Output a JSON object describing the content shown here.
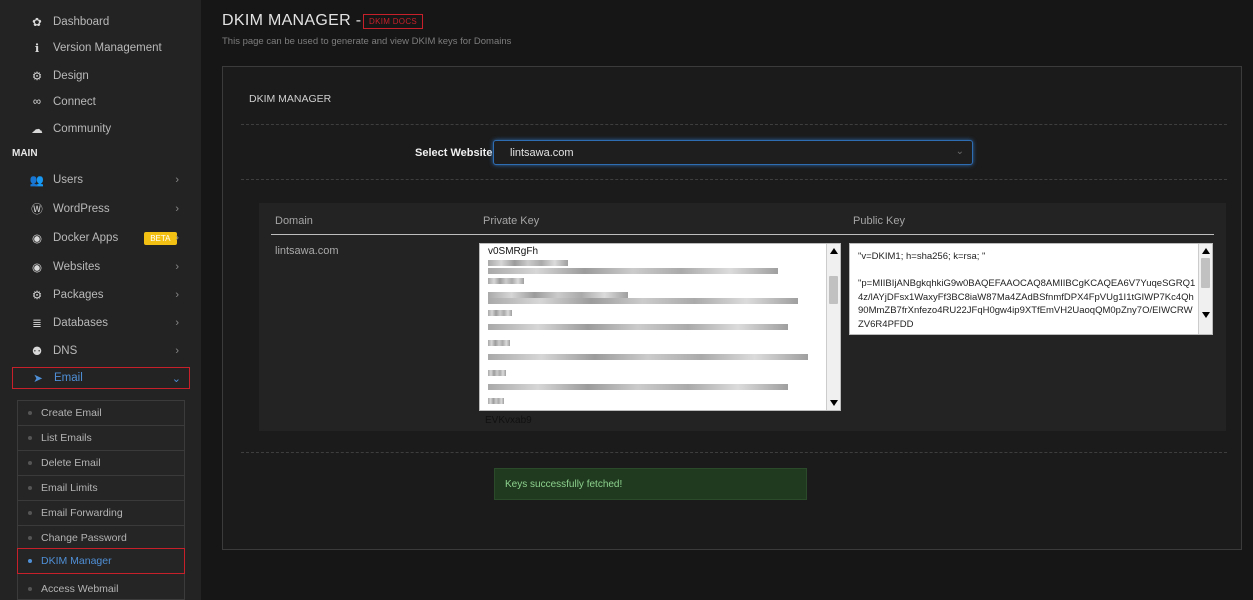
{
  "sidebar": {
    "items": [
      {
        "label": "Dashboard",
        "icon": "dashboard-icon",
        "glyph": "✿"
      },
      {
        "label": "Version Management",
        "icon": "info-icon",
        "glyph": "ℹ"
      },
      {
        "label": "Design",
        "icon": "gear-icon",
        "glyph": "⚙"
      },
      {
        "label": "Connect",
        "icon": "link-icon",
        "glyph": "∞"
      },
      {
        "label": "Community",
        "icon": "chat-icon",
        "glyph": "☁"
      }
    ],
    "section_label": "MAIN",
    "main_items": [
      {
        "label": "Users",
        "icon": "users-icon",
        "glyph": "👥"
      },
      {
        "label": "WordPress",
        "icon": "wordpress-icon",
        "glyph": "Ⓦ"
      },
      {
        "label": "Docker Apps",
        "icon": "docker-icon",
        "glyph": "◉",
        "badge": "BETA"
      },
      {
        "label": "Websites",
        "icon": "globe-icon",
        "glyph": "◉"
      },
      {
        "label": "Packages",
        "icon": "packages-icon",
        "glyph": "⚙"
      },
      {
        "label": "Databases",
        "icon": "database-icon",
        "glyph": "≣"
      },
      {
        "label": "DNS",
        "icon": "network-icon",
        "glyph": "⚉"
      }
    ],
    "email": {
      "label": "Email",
      "icon": "paper-plane-icon",
      "glyph": "➤"
    },
    "email_submenu": [
      "Create Email",
      "List Emails",
      "Delete Email",
      "Email Limits",
      "Email Forwarding",
      "Change Password"
    ],
    "active_sub": "DKIM Manager",
    "after_sub": "Access Webmail"
  },
  "header": {
    "title": "DKIM MANAGER -",
    "docs_badge": "DKIM DOCS",
    "subtitle": "This page can be used to generate and view DKIM keys for Domains"
  },
  "panel": {
    "heading": "DKIM MANAGER",
    "select_label": "Select Website",
    "selected_website": "lintsawa.com"
  },
  "table": {
    "headers": [
      "Domain",
      "Private Key",
      "Public Key"
    ],
    "domain": "lintsawa.com",
    "private_key_first": "v0SMRgFh",
    "private_key_last": "EVKvxab9",
    "public_key": "\"v=DKIM1; h=sha256; k=rsa; \"\n\n\"p=MIIBIjANBgkqhkiG9w0BAQEFAAOCAQ8AMIIBCgKCAQEA6V7YuqeSGRQ14z/lAYjDFsx1WaxyFf3BC8iaW87Ma4ZAdBSfnmfDPX4FpVUg1I1tGIWP7Kc4Qh90MmZB7frXnfezo4RU22JFqH0gw4ip9XTfEmVH2UaoqQM0pZny7O/EIWCRWZV6R4PFDD"
  },
  "alert": {
    "text": "Keys successfully fetched!"
  },
  "colors": {
    "accent": "#4f8fd6",
    "danger": "#c8202a",
    "success_text": "#8ed28e"
  }
}
